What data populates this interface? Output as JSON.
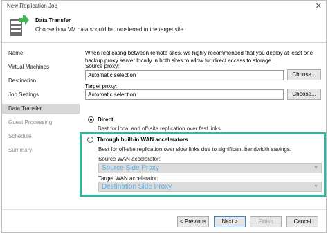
{
  "window": {
    "title": "New Replication Job",
    "close_glyph": "✕"
  },
  "header": {
    "title": "Data Transfer",
    "subtitle": "Choose how VM data should be transferred to the target site.",
    "icon": "wizard-step-icon"
  },
  "sidebar": {
    "items": [
      {
        "label": "Name"
      },
      {
        "label": "Virtual Machines"
      },
      {
        "label": "Destination"
      },
      {
        "label": "Job Settings"
      },
      {
        "label": "Data Transfer"
      },
      {
        "label": "Guest Processing"
      },
      {
        "label": "Schedule"
      },
      {
        "label": "Summary"
      }
    ]
  },
  "main": {
    "intro": "When replicating between remote sites, we highly recommended that you deploy at least one backup proxy server locally in both sites to allow for direct access to storage.",
    "source_proxy_label": "Source proxy:",
    "source_proxy_value": "Automatic selection",
    "target_proxy_label": "Target proxy:",
    "target_proxy_value": "Automatic selection",
    "choose_label": "Choose...",
    "direct_label": "Direct",
    "direct_desc": "Best for local and off-site replication over fast links.",
    "wan_label": "Through built-in WAN accelerators",
    "wan_desc": "Best for off-site replication over slow links due to significant bandwidth savings.",
    "source_wan_label": "Source WAN accelerator:",
    "source_wan_value": "Source Side Proxy",
    "target_wan_label": "Target WAN accelerator:",
    "target_wan_value": "Destination Side Proxy",
    "dropdown_glyph": "▼"
  },
  "footer": {
    "previous": "< Previous",
    "next": "Next >",
    "finish": "Finish",
    "cancel": "Cancel"
  },
  "colors": {
    "highlight_border": "#32b49f",
    "wan_text": "#5ab0e6",
    "active_item": "#d7d7d7"
  }
}
